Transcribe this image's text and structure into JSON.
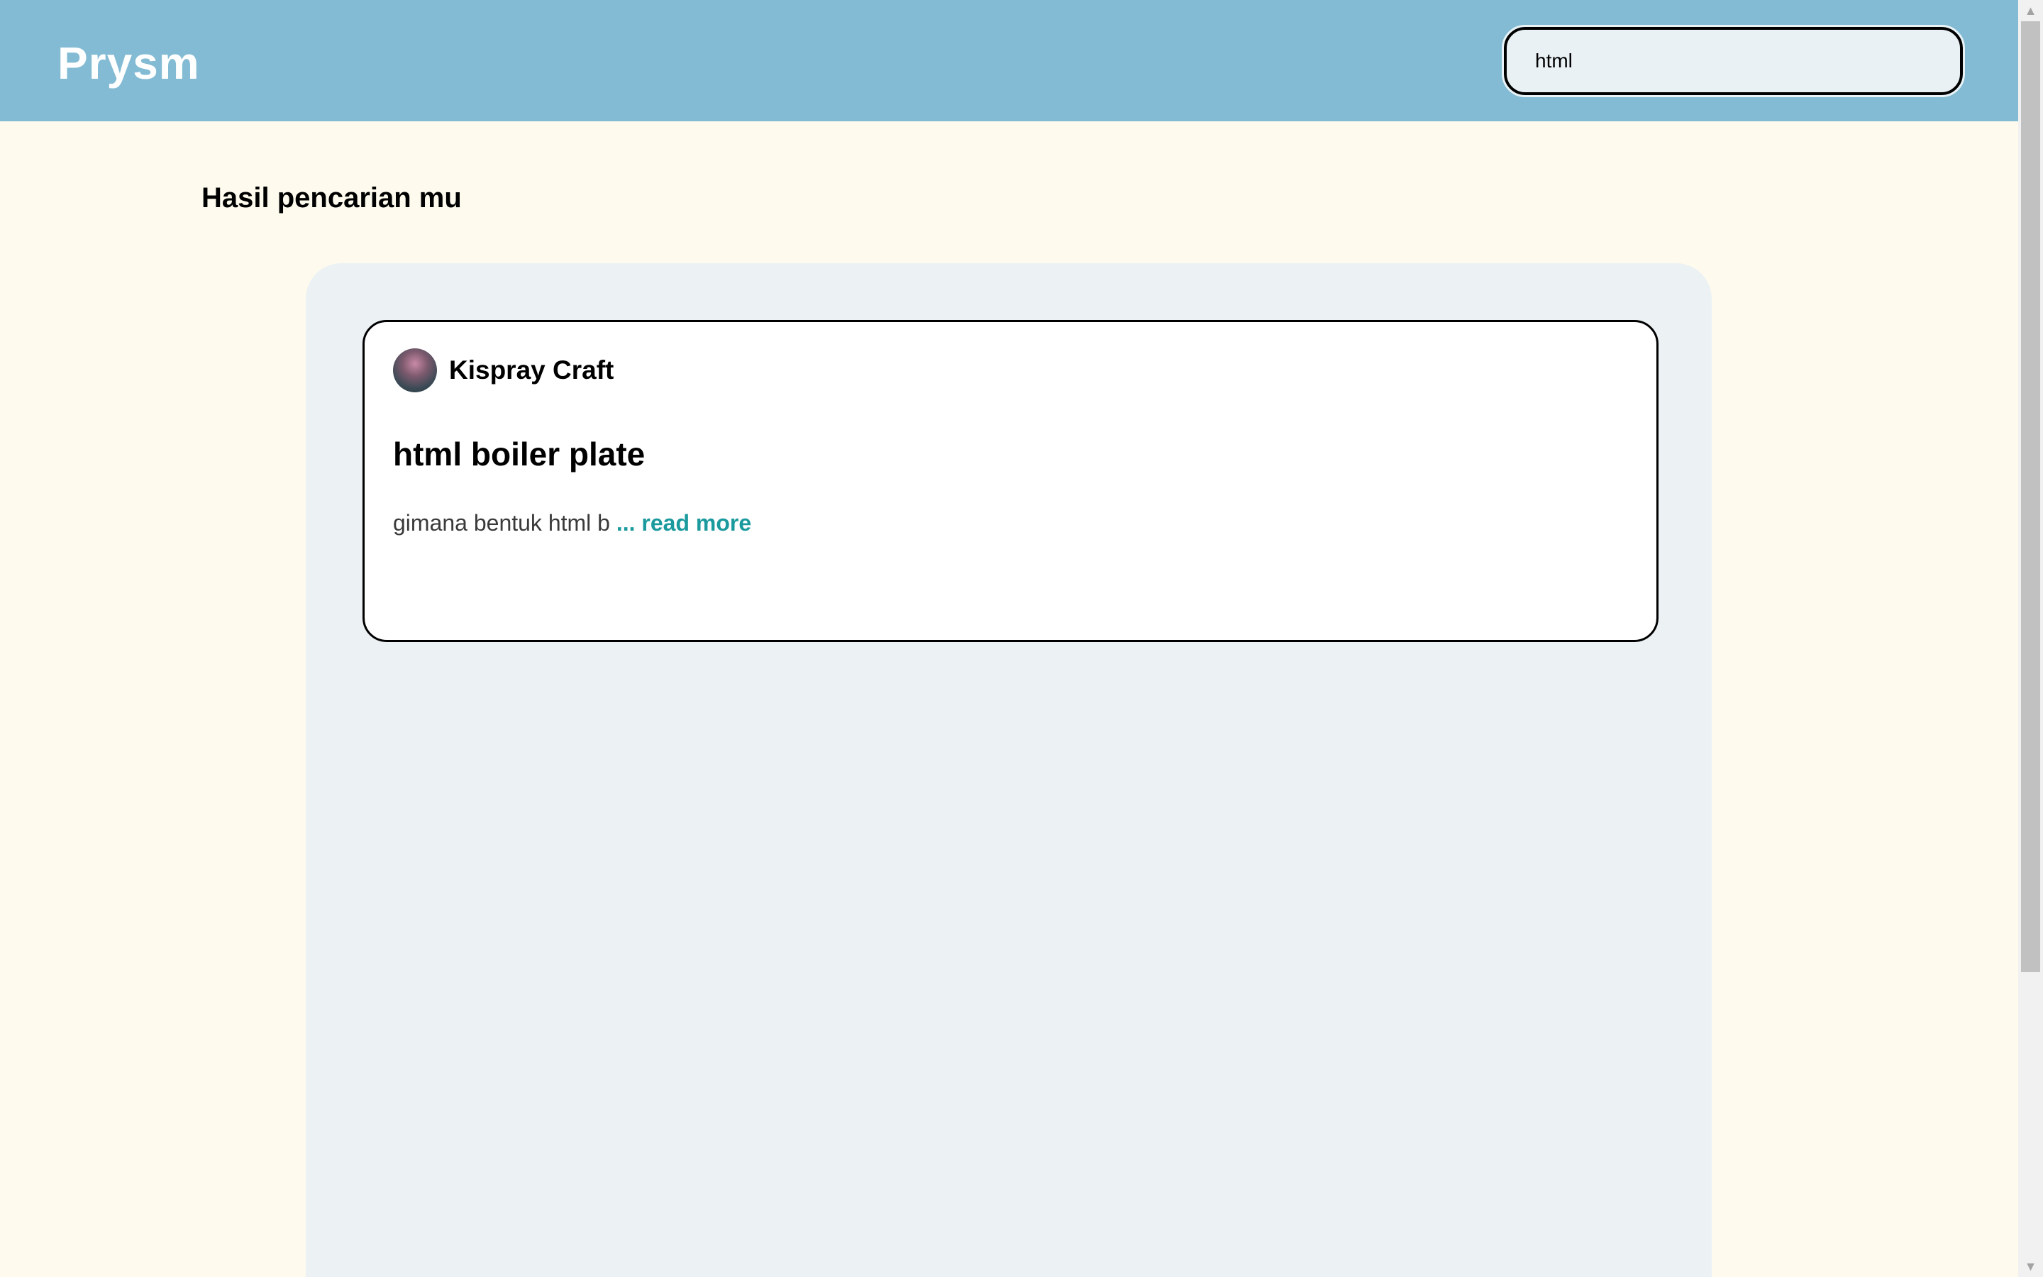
{
  "header": {
    "logo": "Prysm",
    "search": {
      "value": "html",
      "placeholder": ""
    }
  },
  "main": {
    "heading": "Hasil pencarian mu",
    "posts": [
      {
        "author": "Kispray Craft",
        "avatar_icon": "user-avatar",
        "title": "html boiler plate",
        "excerpt": "gimana bentuk html b",
        "read_more": "... read more"
      }
    ]
  },
  "colors": {
    "header_bg": "#82bbd3",
    "page_bg": "#fefbee",
    "panel_bg": "#ecf1f4",
    "link": "#1b9a9e"
  }
}
